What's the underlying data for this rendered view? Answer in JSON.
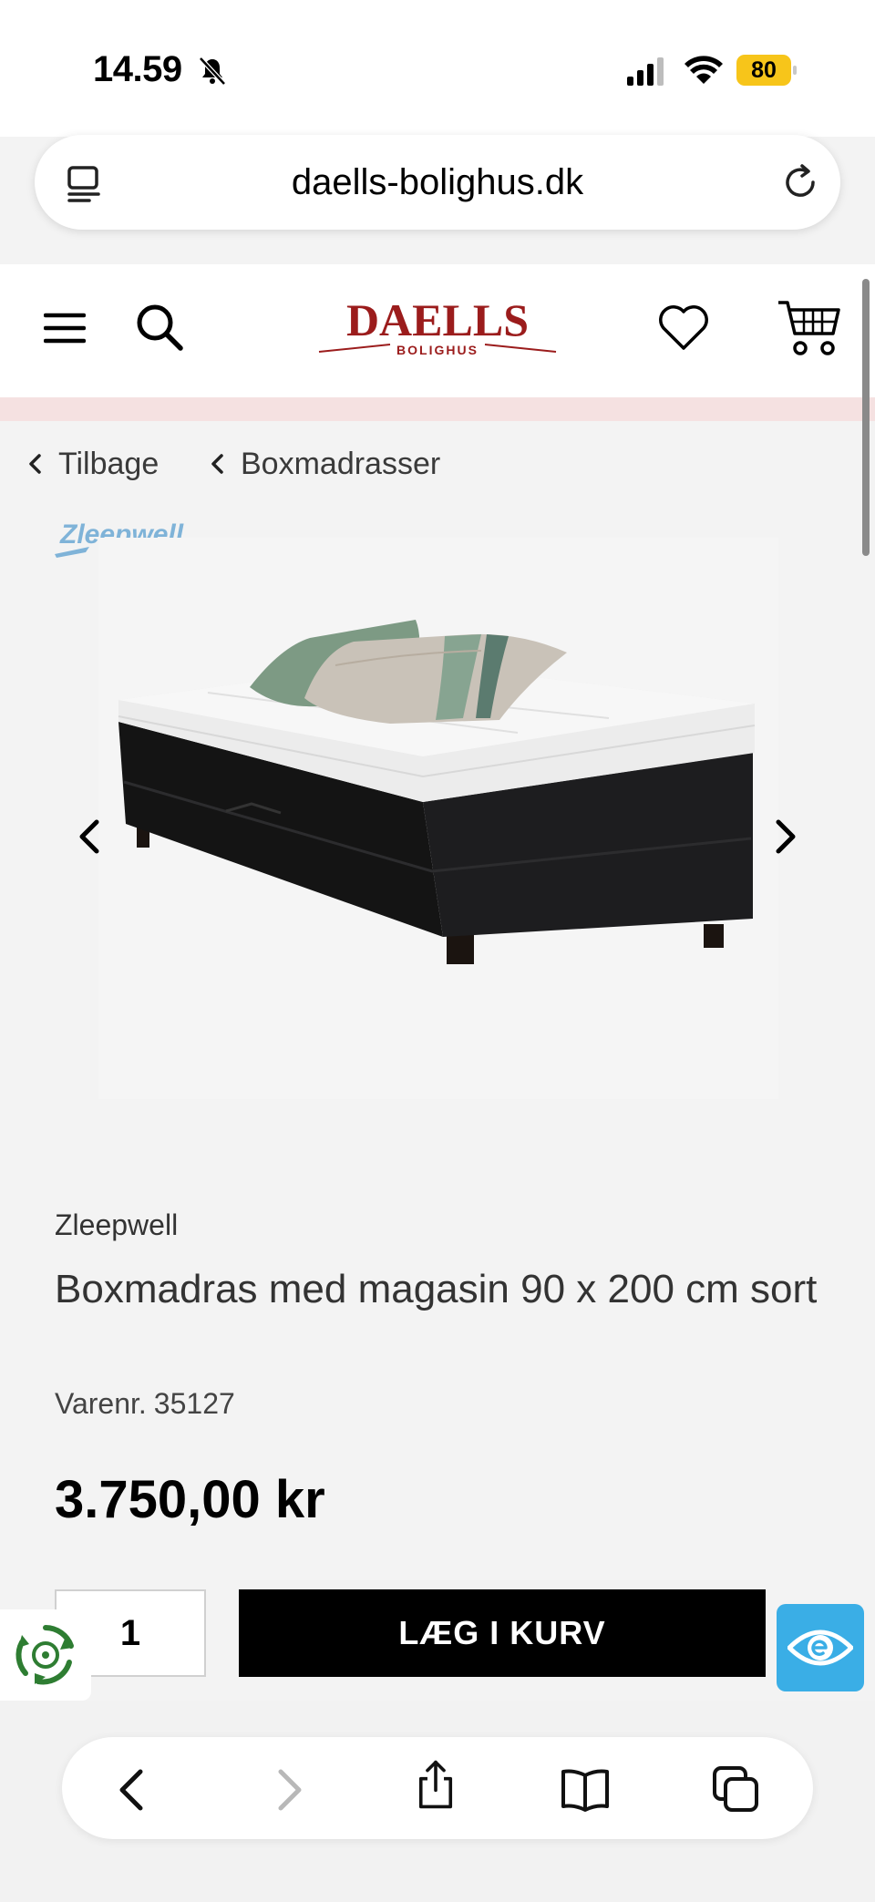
{
  "status_bar": {
    "time": "14.59",
    "battery_level": "80"
  },
  "browser": {
    "url": "daells-bolighus.dk"
  },
  "header": {
    "logo_text": "DAELLS",
    "logo_subtext": "BOLIGHUS",
    "logo_color": "#9b1c1c"
  },
  "breadcrumbs": {
    "back_label": "Tilbage",
    "category_label": "Boxmadrasser"
  },
  "product": {
    "brand_logo_text": "Zleepwell",
    "brand": "Zleepwell",
    "title": "Boxmadras med magasin 90 x 200 cm sort",
    "sku_label": "Varenr.",
    "sku": "35127",
    "price": "3.750,00 kr",
    "quantity": "1",
    "add_to_cart_label": "LÆG I KURV"
  },
  "colors": {
    "accent": "#000000",
    "promo_strip": "#f5e1e1",
    "accessibility_widget": "#3aaee6",
    "recycle_widget": "#2e7d32"
  }
}
